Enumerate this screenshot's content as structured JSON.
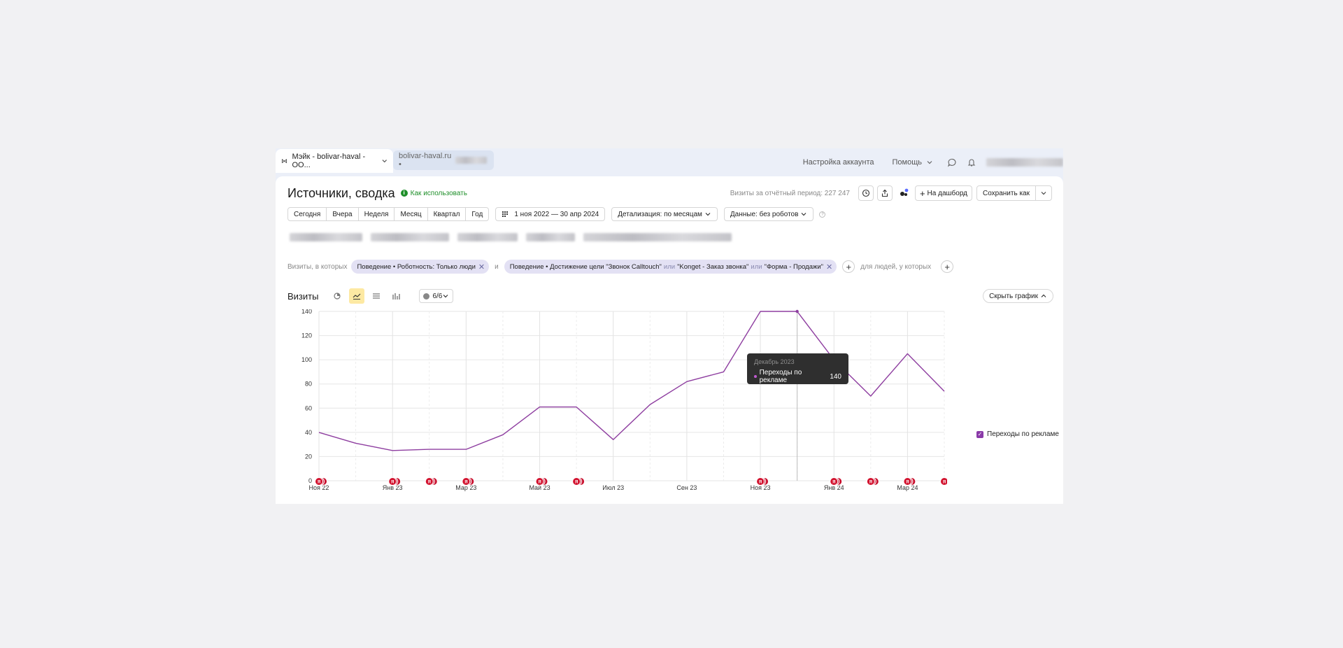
{
  "topbar": {
    "active_tab": "Мэйк - bolivar-haval - ОО...",
    "second_tab": "bolivar-haval.ru  •",
    "account_settings": "Настройка аккаунта",
    "help": "Помощь"
  },
  "header": {
    "title": "Источники, сводка",
    "how_to_use": "Как использовать",
    "visits_period": "Визиты за отчётный период: 227 247",
    "to_dashboard": "На дашборд",
    "save_as": "Сохранить как"
  },
  "period": {
    "buttons": [
      "Сегодня",
      "Вчера",
      "Неделя",
      "Месяц",
      "Квартал",
      "Год"
    ],
    "date_range": "1 ноя 2022 — 30 апр 2024",
    "detail": "Детализация: по месяцам",
    "data": "Данные: без роботов"
  },
  "segments": {
    "label": "Визиты, в которых",
    "chip1": "Поведение • Роботность: Только люди",
    "and": "и",
    "chip2_a": "Поведение • Достижение цели \"Звонок Calltouch\"",
    "or1": "или",
    "chip2_b": "\"Konget - Заказ звонка\"",
    "or2": "или",
    "chip2_c": "\"Форма - Продажи\"",
    "people_label": "для людей, у которых"
  },
  "chart_header": {
    "title": "Визиты",
    "notes": "6/6",
    "hide": "Скрыть график"
  },
  "tooltip": {
    "date": "Декабрь 2023",
    "series": "Переходы по рекламе",
    "value": "140"
  },
  "legend": {
    "series": "Переходы по рекламе"
  },
  "chart_data": {
    "type": "line",
    "x": [
      "2022-11",
      "2022-12",
      "2023-01",
      "2023-02",
      "2023-03",
      "2023-04",
      "2023-05",
      "2023-06",
      "2023-07",
      "2023-08",
      "2023-09",
      "2023-10",
      "2023-11",
      "2023-12",
      "2024-01",
      "2024-02",
      "2024-03",
      "2024-04"
    ],
    "series": [
      {
        "name": "Переходы по рекламе",
        "values": [
          40,
          31,
          25,
          26,
          26,
          38,
          61,
          61,
          34,
          63,
          82,
          90,
          140,
          140,
          100,
          70,
          105,
          74
        ]
      }
    ],
    "tick_labels": [
      "Ноя 22",
      "Янв 23",
      "Мар 23",
      "Май 23",
      "Июл 23",
      "Сен 23",
      "Ноя 23",
      "Янв 24",
      "Мар 24"
    ],
    "y_ticks": [
      "0",
      "20",
      "40",
      "60",
      "80",
      "100",
      "120",
      "140"
    ],
    "ylim": [
      0,
      140
    ],
    "grid": true,
    "legend": "right",
    "line_color": "#8e3ea0",
    "highlight_index": 13,
    "annotation_months": [
      0,
      2,
      3,
      4,
      6,
      7,
      12,
      14,
      15,
      16,
      17
    ],
    "annotation_marker": "Я"
  }
}
